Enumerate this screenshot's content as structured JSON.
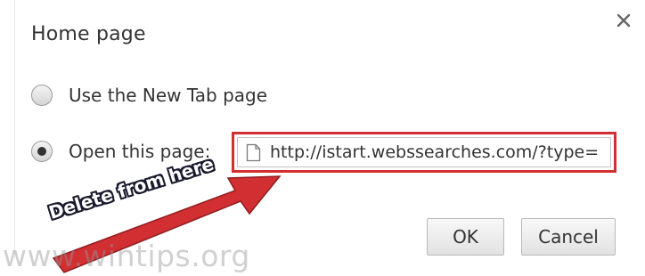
{
  "dialog": {
    "title": "Home page",
    "close_icon": "close-icon"
  },
  "options": [
    {
      "label": "Use the New Tab page",
      "selected": false
    },
    {
      "label": "Open this page:",
      "selected": true
    }
  ],
  "url_field": {
    "value": "http://istart.webssearches.com/?type=",
    "icon": "page-icon"
  },
  "annotation": {
    "text": "Delete from here",
    "arrow_color": "#d22f33"
  },
  "buttons": {
    "ok_label": "OK",
    "cancel_label": "Cancel"
  },
  "watermark": {
    "text": "www.wintips.org"
  },
  "colors": {
    "highlight": "#d22f33",
    "text": "#333333"
  }
}
